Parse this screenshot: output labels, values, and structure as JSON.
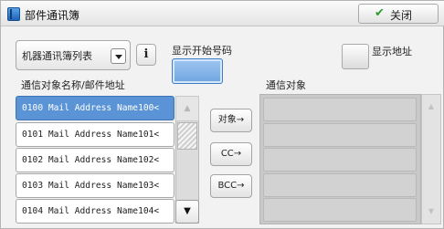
{
  "window": {
    "title": "部件通讯簿",
    "close_label": "关闭"
  },
  "controls": {
    "dropdown_label": "机器通讯簿列表",
    "info_label": "i",
    "start_number_label": "显示开始号码",
    "start_number_value": "",
    "show_address_label": "显示地址"
  },
  "lists": {
    "source_header": "通信对象名称/邮件地址",
    "target_header": "通信对象",
    "rows": [
      "0100 Mail Address Name100<",
      "0101 Mail Address Name101<",
      "0102 Mail Address Name102<",
      "0103 Mail Address Name103<",
      "0104 Mail Address Name104<"
    ],
    "selected_index": 0
  },
  "actions": {
    "to_label": "对象→",
    "cc_label": "CC→",
    "bcc_label": "BCC→"
  },
  "icons": {
    "scroll_up": "▲",
    "scroll_down": "▼",
    "check": "✔"
  },
  "colors": {
    "selected_row": "#5a93d6",
    "start_input": "#7fb0e6",
    "check_icon": "#2f9a2f"
  }
}
